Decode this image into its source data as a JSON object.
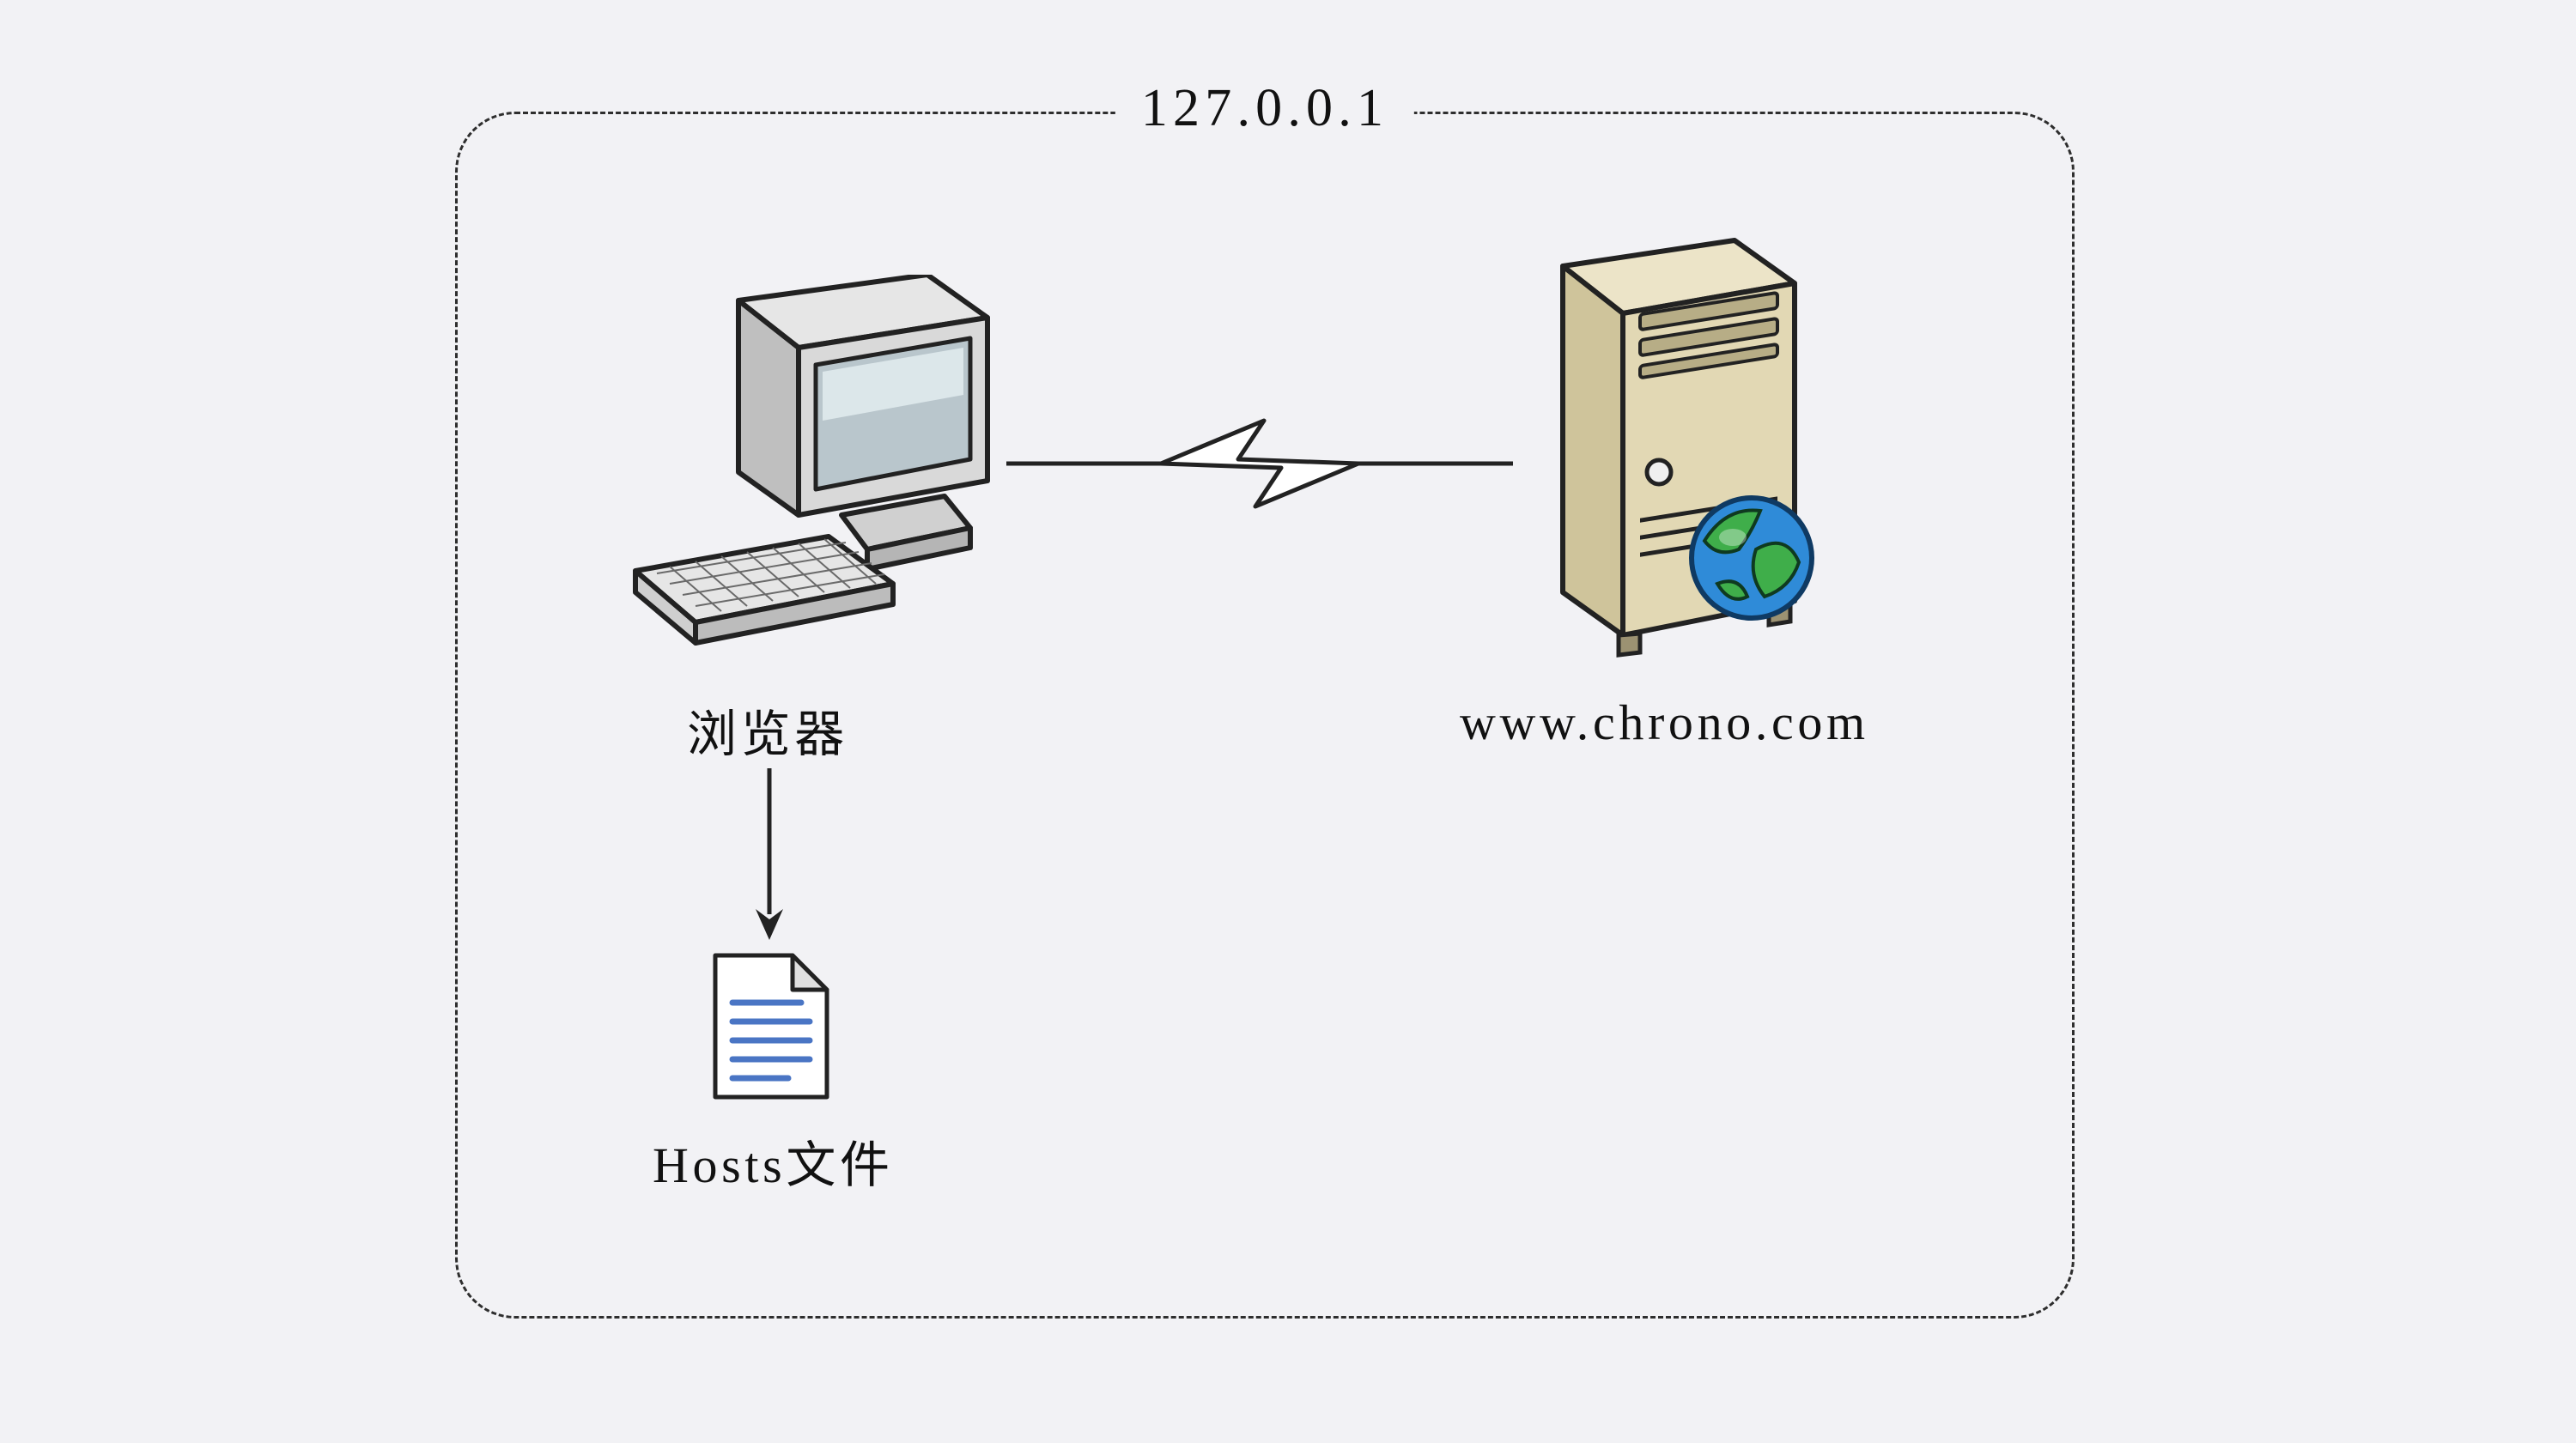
{
  "box": {
    "title": "127.0.0.1"
  },
  "browser": {
    "label": "浏览器"
  },
  "server": {
    "label": "www.chrono.com"
  },
  "hosts": {
    "label": "Hosts文件"
  }
}
